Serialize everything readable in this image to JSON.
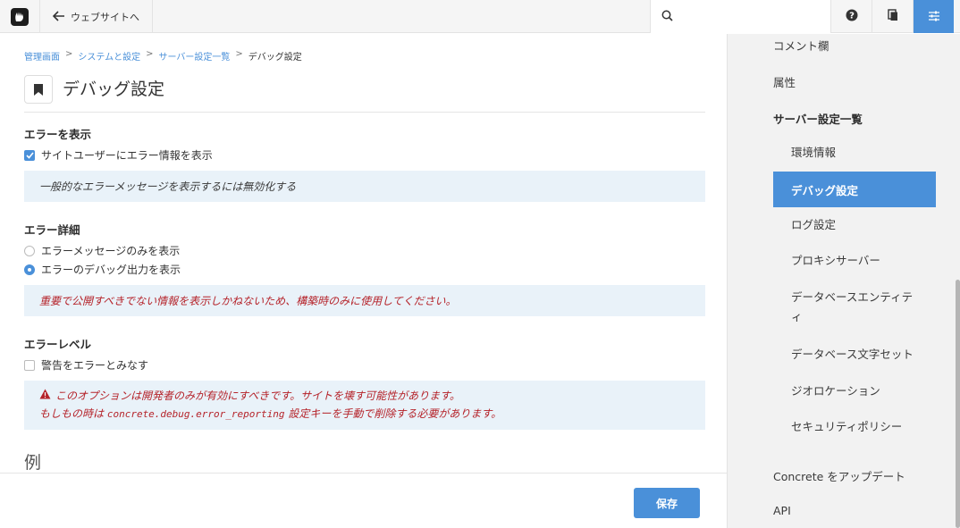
{
  "topbar": {
    "back_label": "ウェブサイトへ",
    "search_placeholder": ""
  },
  "breadcrumb": {
    "items": [
      "管理画面",
      "システムと設定",
      "サーバー設定一覧"
    ],
    "separator": ">",
    "current": "デバッグ設定"
  },
  "page": {
    "title": "デバッグ設定"
  },
  "sections": {
    "display_errors": {
      "label": "エラーを表示",
      "checkbox_label": "サイトユーザーにエラー情報を表示",
      "checked": true,
      "help": "一般的なエラーメッセージを表示するには無効化する"
    },
    "error_detail": {
      "label": "エラー詳細",
      "options": [
        {
          "label": "エラーメッセージのみを表示",
          "selected": false
        },
        {
          "label": "エラーのデバッグ出力を表示",
          "selected": true
        }
      ],
      "warning": "重要で公開すべきでない情報を表示しかねないため、構築時のみに使用してください。"
    },
    "error_level": {
      "label": "エラーレベル",
      "checkbox_label": "警告をエラーとみなす",
      "checked": false,
      "warning_line1": "このオプションは開発者のみが有効にすべきです。サイトを壊す可能性があります。",
      "warning_line2_prefix": "もしもの時は ",
      "warning_code": "concrete.debug.error_reporting",
      "warning_line2_suffix": " 設定キーを手動で削除する必要があります。"
    },
    "example": {
      "label": "例"
    }
  },
  "footer": {
    "save_label": "保存"
  },
  "sidebar": {
    "items_top": [
      "コメント欄",
      "属性"
    ],
    "group_label": "サーバー設定一覧",
    "sub_items": [
      {
        "label": "環境情報",
        "active": false
      },
      {
        "label": "デバッグ設定",
        "active": true
      },
      {
        "label": "ログ設定",
        "active": false
      },
      {
        "label": "プロキシサーバー",
        "active": false
      },
      {
        "label": "データベースエンティティ",
        "active": false
      },
      {
        "label": "データベース文字セット",
        "active": false
      },
      {
        "label": "ジオロケーション",
        "active": false
      },
      {
        "label": "セキュリティポリシー",
        "active": false
      }
    ],
    "items_bottom": [
      "Concrete をアップデート",
      "API"
    ]
  },
  "colors": {
    "accent": "#4a90d9",
    "note_bg": "#e9f2f9",
    "danger": "#b5232a",
    "sidebar_bg": "#f2f2f2"
  },
  "icons": {
    "logo": "concrete-hand-logo",
    "back": "arrow-left-icon",
    "search": "search-icon",
    "help": "help-circle-icon",
    "pages": "pages-icon",
    "settings": "sliders-icon",
    "page_title": "bookmark-icon",
    "warning": "warning-triangle-icon"
  }
}
